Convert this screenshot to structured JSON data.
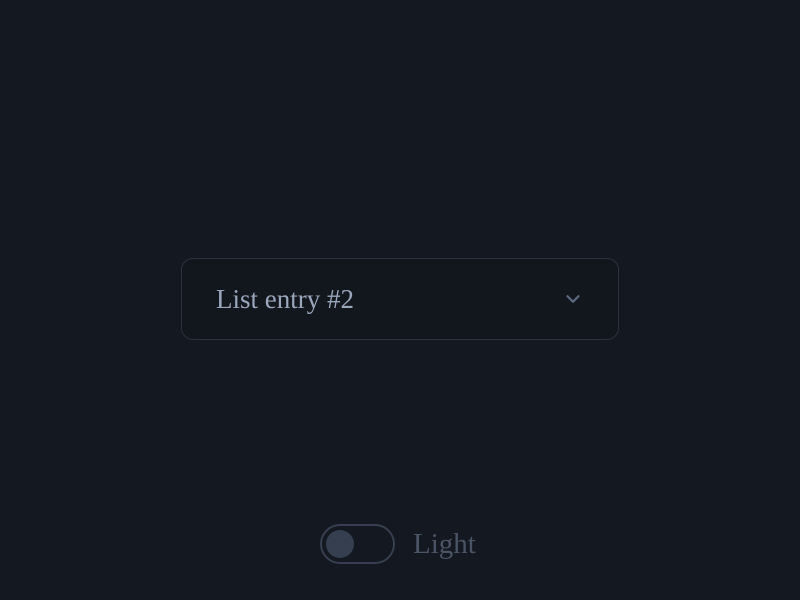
{
  "dropdown": {
    "selected": "List entry #2"
  },
  "theme_toggle": {
    "label": "Light",
    "on": false
  }
}
